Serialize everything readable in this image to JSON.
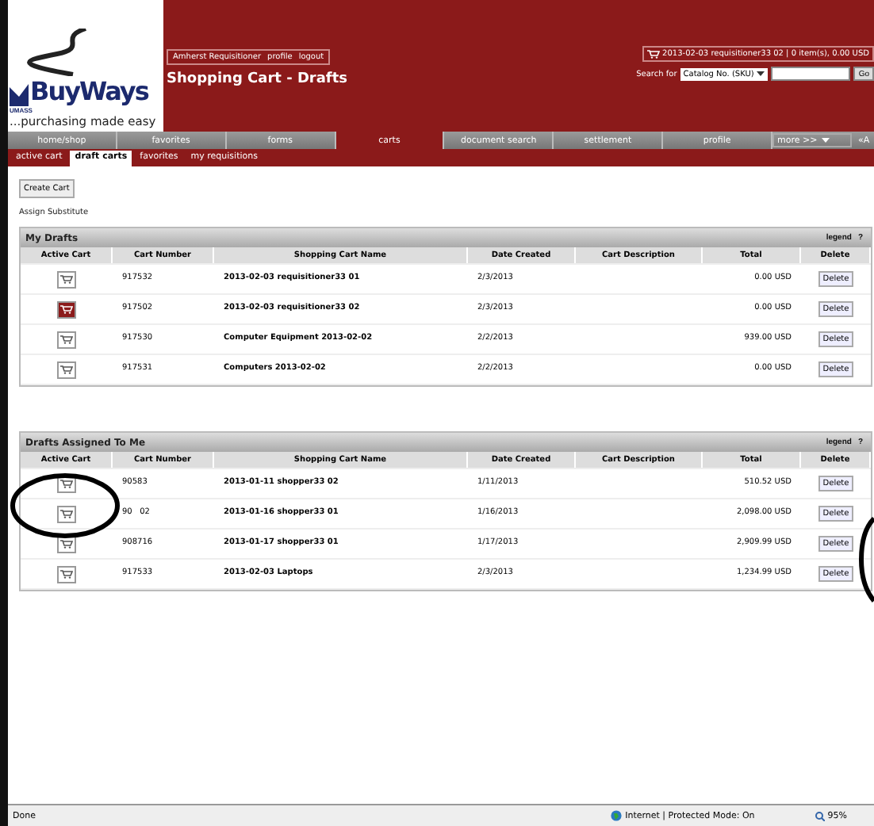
{
  "header": {
    "brand": "BuyWays",
    "brand_tag": "UMASS",
    "tagline": "...purchasing made easy",
    "user_links": [
      "Amherst Requisitioner",
      "profile",
      "logout"
    ],
    "page_title": "Shopping Cart - Drafts",
    "cart_summary": "2013-02-03 requisitioner33 02 | 0 item(s), 0.00 USD",
    "search_label": "Search for",
    "search_type": "Catalog No. (SKU)",
    "go": "Go"
  },
  "nav": [
    {
      "label": "home/shop",
      "selected": false
    },
    {
      "label": "favorites",
      "selected": false
    },
    {
      "label": "forms",
      "selected": false
    },
    {
      "label": "carts",
      "selected": true
    },
    {
      "label": "document search",
      "selected": false
    },
    {
      "label": "settlement",
      "selected": false
    },
    {
      "label": "profile",
      "selected": false
    }
  ],
  "nav_more": "more >>",
  "nav_cut": "«A",
  "subtabs": [
    {
      "label": "active cart",
      "selected": false
    },
    {
      "label": "draft carts",
      "selected": true
    },
    {
      "label": "favorites",
      "selected": false
    },
    {
      "label": "my requisitions",
      "selected": false
    }
  ],
  "create_cart": "Create Cart",
  "assign_substitute": "Assign Substitute",
  "sections": [
    {
      "title": "My Drafts",
      "legend": "legend",
      "help": "?",
      "columns": [
        "Active Cart",
        "Cart Number",
        "Shopping Cart Name",
        "Date Created",
        "Cart Description",
        "Total",
        "Delete"
      ],
      "rows": [
        {
          "active": false,
          "number": "917532",
          "name": "2013-02-03 requisitioner33 01",
          "date": "2/3/2013",
          "total": "0.00 USD",
          "delete": "Delete"
        },
        {
          "active": true,
          "number": "917502",
          "name": "2013-02-03 requisitioner33 02",
          "date": "2/3/2013",
          "total": "0.00 USD",
          "delete": "Delete"
        },
        {
          "active": false,
          "number": "917530",
          "name": "Computer Equipment 2013-02-02",
          "date": "2/2/2013",
          "total": "939.00 USD",
          "delete": "Delete"
        },
        {
          "active": false,
          "number": "917531",
          "name": "Computers 2013-02-02",
          "date": "2/2/2013",
          "total": "0.00 USD",
          "delete": "Delete"
        }
      ]
    },
    {
      "title": "Drafts Assigned To Me",
      "legend": "legend",
      "help": "?",
      "columns": [
        "Active Cart",
        "Cart Number",
        "Shopping Cart Name",
        "Date Created",
        "Cart Description",
        "Total",
        "Delete"
      ],
      "rows": [
        {
          "active": false,
          "number": "90583",
          "name": "2013-01-11 shopper33 02",
          "date": "1/11/2013",
          "total": "510.52 USD",
          "delete": "Delete"
        },
        {
          "active": false,
          "number": "90   02",
          "name": "2013-01-16 shopper33 01",
          "date": "1/16/2013",
          "total": "2,098.00 USD",
          "delete": "Delete"
        },
        {
          "active": false,
          "number": "908716",
          "name": "2013-01-17 shopper33 01",
          "date": "1/17/2013",
          "total": "2,909.99 USD",
          "delete": "Delete"
        },
        {
          "active": false,
          "number": "917533",
          "name": "2013-02-03 Laptops",
          "date": "2/3/2013",
          "total": "1,234.99 USD",
          "delete": "Delete"
        }
      ]
    }
  ],
  "status_bar": {
    "left": "Done",
    "zone": "Internet | Protected Mode: On",
    "zoom": "95%"
  }
}
